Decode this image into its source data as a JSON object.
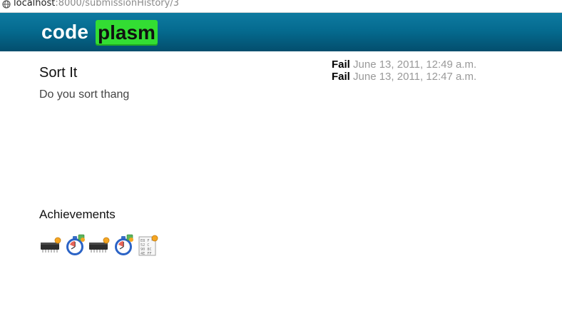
{
  "browser": {
    "url_host": "localhost",
    "url_rest": ":8000/submissionHistory/3",
    "globe_icon": "globe-icon"
  },
  "header": {
    "logo_left": "code",
    "logo_right": "plasm",
    "colors": {
      "banner": "#056b90",
      "logo_accent": "#33dd33"
    }
  },
  "problem": {
    "title": "Sort It",
    "description": "Do you sort thang"
  },
  "submissions": [
    {
      "status": "Fail",
      "timestamp": "June 13, 2011, 12:49 a.m."
    },
    {
      "status": "Fail",
      "timestamp": "June 13, 2011, 12:47 a.m."
    }
  ],
  "achievements": {
    "title": "Achievements",
    "badges": [
      {
        "icon": "memory-chip-icon"
      },
      {
        "icon": "stopwatch-icon"
      },
      {
        "icon": "memory-chip-icon"
      },
      {
        "icon": "stopwatch-icon"
      },
      {
        "icon": "hex-dump-icon",
        "lines": [
          "E8 F",
          "52 C",
          "90 8C",
          "4E FF"
        ]
      }
    ]
  }
}
